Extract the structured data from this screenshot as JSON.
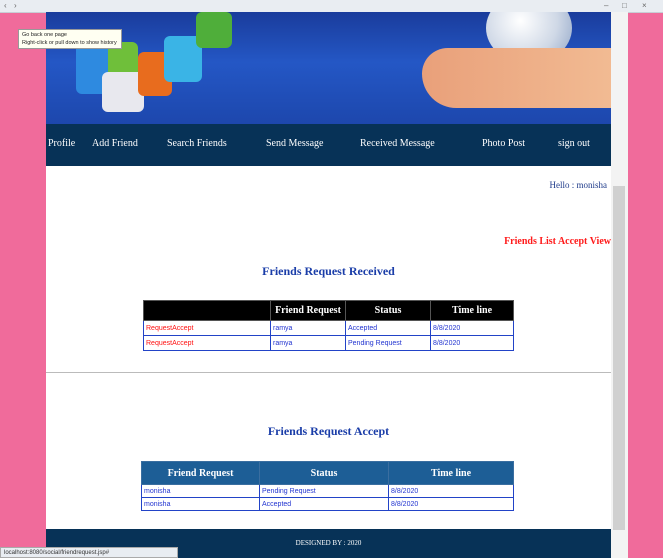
{
  "browser": {
    "back_icon": "back-arrow-icon",
    "forward_icon": "forward-arrow-icon",
    "minimize": "–",
    "maximize": "□",
    "close": "×"
  },
  "tooltip": {
    "line1": "Go back one page",
    "line2": "Right-click or pull down to show history"
  },
  "nav": {
    "items": [
      "Profile",
      "Add Friend",
      "Search Friends",
      "Send Message",
      "Received Message",
      "Photo Post",
      "sign out"
    ]
  },
  "greeting": "Hello : monisha",
  "view_link": "Friends List Accept View",
  "received": {
    "title": "Friends Request Received",
    "headers": [
      "",
      "Friend Request",
      "Status",
      "Time line"
    ],
    "rows": [
      {
        "action": "RequestAccept",
        "friend": "ramya",
        "status": "Accepted",
        "time": "8/8/2020"
      },
      {
        "action": "RequestAccept",
        "friend": "ramya",
        "status": "Pending Request",
        "time": "8/8/2020"
      }
    ]
  },
  "accept": {
    "title": "Friends Request Accept",
    "headers": [
      "Friend Request",
      "Status",
      "Time line"
    ],
    "rows": [
      {
        "friend": "monisha",
        "status": "Pending Request",
        "time": "8/8/2020"
      },
      {
        "friend": "monisha",
        "status": "Accepted",
        "time": "8/8/2020"
      }
    ]
  },
  "footer": "DESIGNED BY : 2020",
  "status_url": "localhost:8080/social/friendrequest.jsp#"
}
